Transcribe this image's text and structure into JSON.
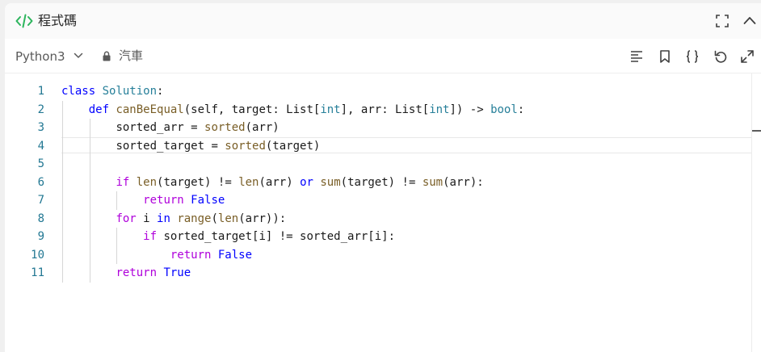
{
  "header": {
    "title": "程式碼"
  },
  "toolbar": {
    "language": "Python3",
    "lock_label": "汽車"
  },
  "editor": {
    "lines": [
      {
        "num": "1",
        "indent": "",
        "segments": [
          {
            "t": "class",
            "c": "kw"
          },
          {
            "t": " "
          },
          {
            "t": "Solution",
            "c": "ty"
          },
          {
            "t": ":"
          }
        ]
      },
      {
        "num": "2",
        "indent": "    ",
        "segments": [
          {
            "t": "def",
            "c": "kw"
          },
          {
            "t": " "
          },
          {
            "t": "canBeEqual",
            "c": "fn"
          },
          {
            "t": "(self, target: List["
          },
          {
            "t": "int",
            "c": "ty"
          },
          {
            "t": "], arr: List["
          },
          {
            "t": "int",
            "c": "ty"
          },
          {
            "t": "]) -> "
          },
          {
            "t": "bool",
            "c": "ty"
          },
          {
            "t": ":"
          }
        ]
      },
      {
        "num": "3",
        "indent": "        ",
        "segments": [
          {
            "t": "sorted_arr = "
          },
          {
            "t": "sorted",
            "c": "fn"
          },
          {
            "t": "(arr)"
          }
        ]
      },
      {
        "num": "4",
        "indent": "        ",
        "segments": [
          {
            "t": "sorted_target = "
          },
          {
            "t": "sorted",
            "c": "fn"
          },
          {
            "t": "(target)"
          }
        ]
      },
      {
        "num": "5",
        "indent": "",
        "segments": []
      },
      {
        "num": "6",
        "indent": "        ",
        "segments": [
          {
            "t": "if",
            "c": "kw2"
          },
          {
            "t": " "
          },
          {
            "t": "len",
            "c": "fn"
          },
          {
            "t": "(target) != "
          },
          {
            "t": "len",
            "c": "fn"
          },
          {
            "t": "(arr) "
          },
          {
            "t": "or",
            "c": "kw"
          },
          {
            "t": " "
          },
          {
            "t": "sum",
            "c": "fn"
          },
          {
            "t": "(target) != "
          },
          {
            "t": "sum",
            "c": "fn"
          },
          {
            "t": "(arr):"
          }
        ]
      },
      {
        "num": "7",
        "indent": "            ",
        "segments": [
          {
            "t": "return",
            "c": "kw2"
          },
          {
            "t": " "
          },
          {
            "t": "False",
            "c": "kw"
          }
        ]
      },
      {
        "num": "8",
        "indent": "        ",
        "segments": [
          {
            "t": "for",
            "c": "kw2"
          },
          {
            "t": " i "
          },
          {
            "t": "in",
            "c": "kw"
          },
          {
            "t": " "
          },
          {
            "t": "range",
            "c": "fn"
          },
          {
            "t": "("
          },
          {
            "t": "len",
            "c": "fn"
          },
          {
            "t": "(arr)):"
          }
        ]
      },
      {
        "num": "9",
        "indent": "            ",
        "segments": [
          {
            "t": "if",
            "c": "kw2"
          },
          {
            "t": " sorted_target[i] != sorted_arr[i]:"
          }
        ]
      },
      {
        "num": "10",
        "indent": "                ",
        "segments": [
          {
            "t": "return",
            "c": "kw2"
          },
          {
            "t": " "
          },
          {
            "t": "False",
            "c": "kw"
          }
        ]
      },
      {
        "num": "11",
        "indent": "        ",
        "segments": [
          {
            "t": "return",
            "c": "kw2"
          },
          {
            "t": " "
          },
          {
            "t": "True",
            "c": "kw"
          }
        ]
      }
    ]
  },
  "colors": {
    "code_icon": "#2db55d",
    "line_number": "#237893",
    "keyword": "#0000ff",
    "control": "#af00db",
    "function": "#795e26",
    "type": "#267f99"
  }
}
